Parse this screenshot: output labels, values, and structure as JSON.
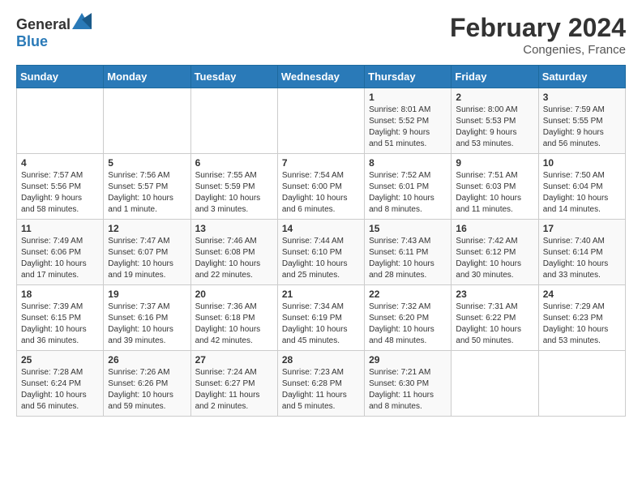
{
  "header": {
    "logo_general": "General",
    "logo_blue": "Blue",
    "title": "February 2024",
    "subtitle": "Congenies, France"
  },
  "days_of_week": [
    "Sunday",
    "Monday",
    "Tuesday",
    "Wednesday",
    "Thursday",
    "Friday",
    "Saturday"
  ],
  "weeks": [
    [
      {
        "num": "",
        "info": ""
      },
      {
        "num": "",
        "info": ""
      },
      {
        "num": "",
        "info": ""
      },
      {
        "num": "",
        "info": ""
      },
      {
        "num": "1",
        "info": "Sunrise: 8:01 AM\nSunset: 5:52 PM\nDaylight: 9 hours\nand 51 minutes."
      },
      {
        "num": "2",
        "info": "Sunrise: 8:00 AM\nSunset: 5:53 PM\nDaylight: 9 hours\nand 53 minutes."
      },
      {
        "num": "3",
        "info": "Sunrise: 7:59 AM\nSunset: 5:55 PM\nDaylight: 9 hours\nand 56 minutes."
      }
    ],
    [
      {
        "num": "4",
        "info": "Sunrise: 7:57 AM\nSunset: 5:56 PM\nDaylight: 9 hours\nand 58 minutes."
      },
      {
        "num": "5",
        "info": "Sunrise: 7:56 AM\nSunset: 5:57 PM\nDaylight: 10 hours\nand 1 minute."
      },
      {
        "num": "6",
        "info": "Sunrise: 7:55 AM\nSunset: 5:59 PM\nDaylight: 10 hours\nand 3 minutes."
      },
      {
        "num": "7",
        "info": "Sunrise: 7:54 AM\nSunset: 6:00 PM\nDaylight: 10 hours\nand 6 minutes."
      },
      {
        "num": "8",
        "info": "Sunrise: 7:52 AM\nSunset: 6:01 PM\nDaylight: 10 hours\nand 8 minutes."
      },
      {
        "num": "9",
        "info": "Sunrise: 7:51 AM\nSunset: 6:03 PM\nDaylight: 10 hours\nand 11 minutes."
      },
      {
        "num": "10",
        "info": "Sunrise: 7:50 AM\nSunset: 6:04 PM\nDaylight: 10 hours\nand 14 minutes."
      }
    ],
    [
      {
        "num": "11",
        "info": "Sunrise: 7:49 AM\nSunset: 6:06 PM\nDaylight: 10 hours\nand 17 minutes."
      },
      {
        "num": "12",
        "info": "Sunrise: 7:47 AM\nSunset: 6:07 PM\nDaylight: 10 hours\nand 19 minutes."
      },
      {
        "num": "13",
        "info": "Sunrise: 7:46 AM\nSunset: 6:08 PM\nDaylight: 10 hours\nand 22 minutes."
      },
      {
        "num": "14",
        "info": "Sunrise: 7:44 AM\nSunset: 6:10 PM\nDaylight: 10 hours\nand 25 minutes."
      },
      {
        "num": "15",
        "info": "Sunrise: 7:43 AM\nSunset: 6:11 PM\nDaylight: 10 hours\nand 28 minutes."
      },
      {
        "num": "16",
        "info": "Sunrise: 7:42 AM\nSunset: 6:12 PM\nDaylight: 10 hours\nand 30 minutes."
      },
      {
        "num": "17",
        "info": "Sunrise: 7:40 AM\nSunset: 6:14 PM\nDaylight: 10 hours\nand 33 minutes."
      }
    ],
    [
      {
        "num": "18",
        "info": "Sunrise: 7:39 AM\nSunset: 6:15 PM\nDaylight: 10 hours\nand 36 minutes."
      },
      {
        "num": "19",
        "info": "Sunrise: 7:37 AM\nSunset: 6:16 PM\nDaylight: 10 hours\nand 39 minutes."
      },
      {
        "num": "20",
        "info": "Sunrise: 7:36 AM\nSunset: 6:18 PM\nDaylight: 10 hours\nand 42 minutes."
      },
      {
        "num": "21",
        "info": "Sunrise: 7:34 AM\nSunset: 6:19 PM\nDaylight: 10 hours\nand 45 minutes."
      },
      {
        "num": "22",
        "info": "Sunrise: 7:32 AM\nSunset: 6:20 PM\nDaylight: 10 hours\nand 48 minutes."
      },
      {
        "num": "23",
        "info": "Sunrise: 7:31 AM\nSunset: 6:22 PM\nDaylight: 10 hours\nand 50 minutes."
      },
      {
        "num": "24",
        "info": "Sunrise: 7:29 AM\nSunset: 6:23 PM\nDaylight: 10 hours\nand 53 minutes."
      }
    ],
    [
      {
        "num": "25",
        "info": "Sunrise: 7:28 AM\nSunset: 6:24 PM\nDaylight: 10 hours\nand 56 minutes."
      },
      {
        "num": "26",
        "info": "Sunrise: 7:26 AM\nSunset: 6:26 PM\nDaylight: 10 hours\nand 59 minutes."
      },
      {
        "num": "27",
        "info": "Sunrise: 7:24 AM\nSunset: 6:27 PM\nDaylight: 11 hours\nand 2 minutes."
      },
      {
        "num": "28",
        "info": "Sunrise: 7:23 AM\nSunset: 6:28 PM\nDaylight: 11 hours\nand 5 minutes."
      },
      {
        "num": "29",
        "info": "Sunrise: 7:21 AM\nSunset: 6:30 PM\nDaylight: 11 hours\nand 8 minutes."
      },
      {
        "num": "",
        "info": ""
      },
      {
        "num": "",
        "info": ""
      }
    ]
  ]
}
